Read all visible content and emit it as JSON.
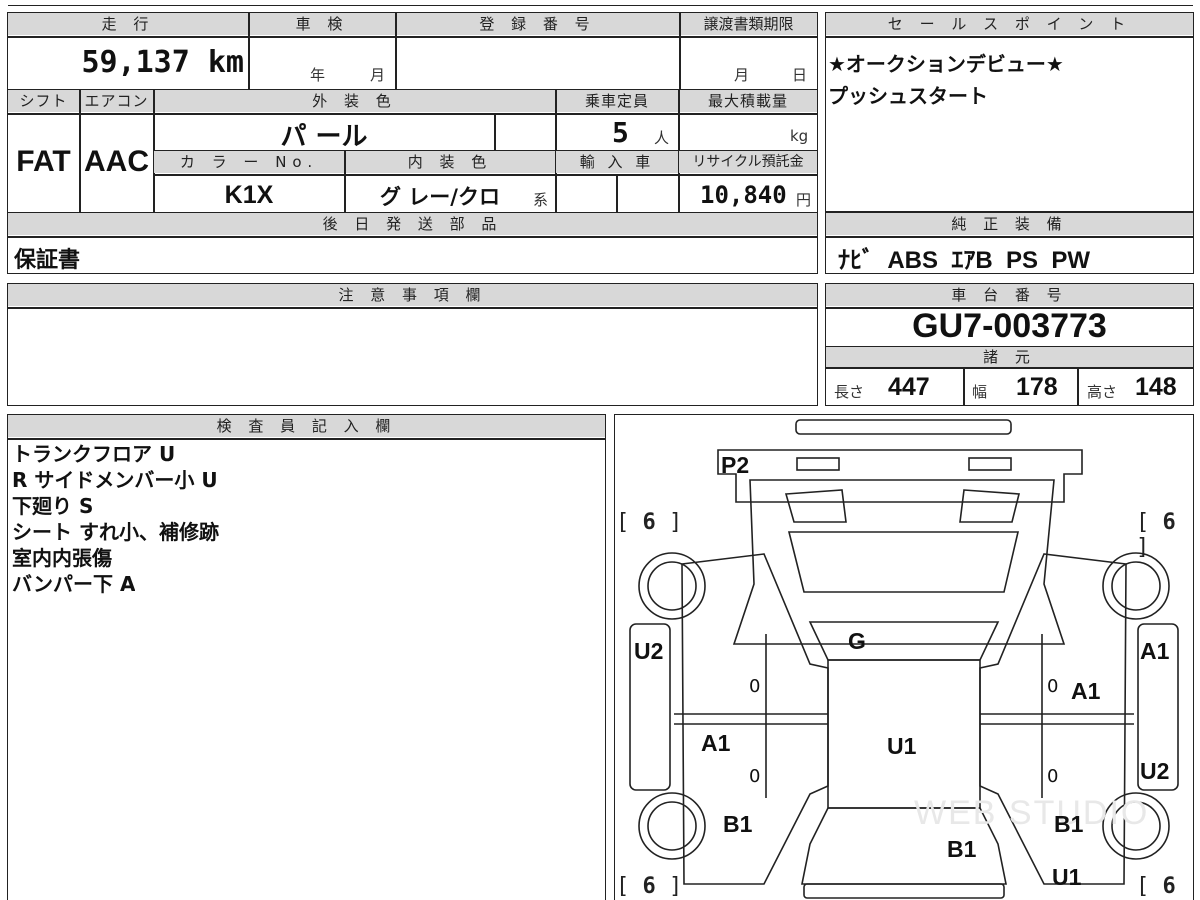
{
  "top_table": {
    "headers": {
      "mileage": "走 行",
      "inspection": "車 検",
      "registration": "登 録 番 号",
      "transfer_deadline": "譲渡書類期限",
      "shift": "シフト",
      "aircon": "エアコン",
      "exterior_color": "外 装 色",
      "capacity": "乗車定員",
      "max_load": "最大積載量",
      "color_no": "カ ラ ー No.",
      "interior_color": "内 装 色",
      "import": "輸 入 車",
      "recycle": "リサイクル預託金",
      "later_parts": "後 日 発 送 部 品"
    },
    "mileage_value": "59,137 km",
    "inspection_year_unit": "年",
    "inspection_month_unit": "月",
    "transfer_month_unit": "月",
    "transfer_day_unit": "日",
    "shift_value": "FAT",
    "aircon_value": "AAC",
    "exterior_color_value": "パ ール",
    "capacity_value": "5",
    "capacity_unit": "人",
    "max_load_unit": "kg",
    "color_no_value": "K1X",
    "interior_color_value": "グ レー/クロ",
    "interior_suffix": "系",
    "recycle_value": "10,840",
    "recycle_unit": "円",
    "later_parts_value": "保証書"
  },
  "sales_point": {
    "header": "セ ー ル ス ポ イ ン ト",
    "lines": [
      "★オークションデビュー★",
      "プッシュスタート"
    ]
  },
  "equipment": {
    "header": "純 正 装 備",
    "value": "ﾅﾋﾞ  ABS  ｴｱB  PS  PW"
  },
  "caution": {
    "header": "注 意 事 項 欄"
  },
  "chassis": {
    "header": "車 台 番 号",
    "value": "GU7-003773",
    "spec_header": "諸 元",
    "length_label": "長さ",
    "length_value": "447",
    "width_label": "幅",
    "width_value": "178",
    "height_label": "高さ",
    "height_value": "148"
  },
  "inspector": {
    "header": "検 査 員 記 入 欄",
    "lines": [
      "トランクフロア U",
      "R サイドメンバー小 U",
      "下廻り S",
      "シート すれ小、補修跡",
      "室内内張傷",
      "バンパー下 A"
    ]
  },
  "diagram": {
    "marks": {
      "rear_bumper": "P2",
      "trunk": "G",
      "roof": "U1",
      "left_rear_fender": "U2",
      "right_rear_fender": "A1",
      "left_rear_door": "A1",
      "right_rear_door": "A1",
      "right_front_door": "U2",
      "left_front_fender": "B1",
      "right_front_fender": "B1",
      "hood": "B1",
      "front_right": "U1"
    },
    "tire_brackets": {
      "rear_left": "6",
      "rear_right": "6",
      "front_left": "6",
      "front_right": "6"
    },
    "door_glass": [
      "0",
      "0",
      "0",
      "0"
    ],
    "watermark": "WEB STUDIO"
  }
}
